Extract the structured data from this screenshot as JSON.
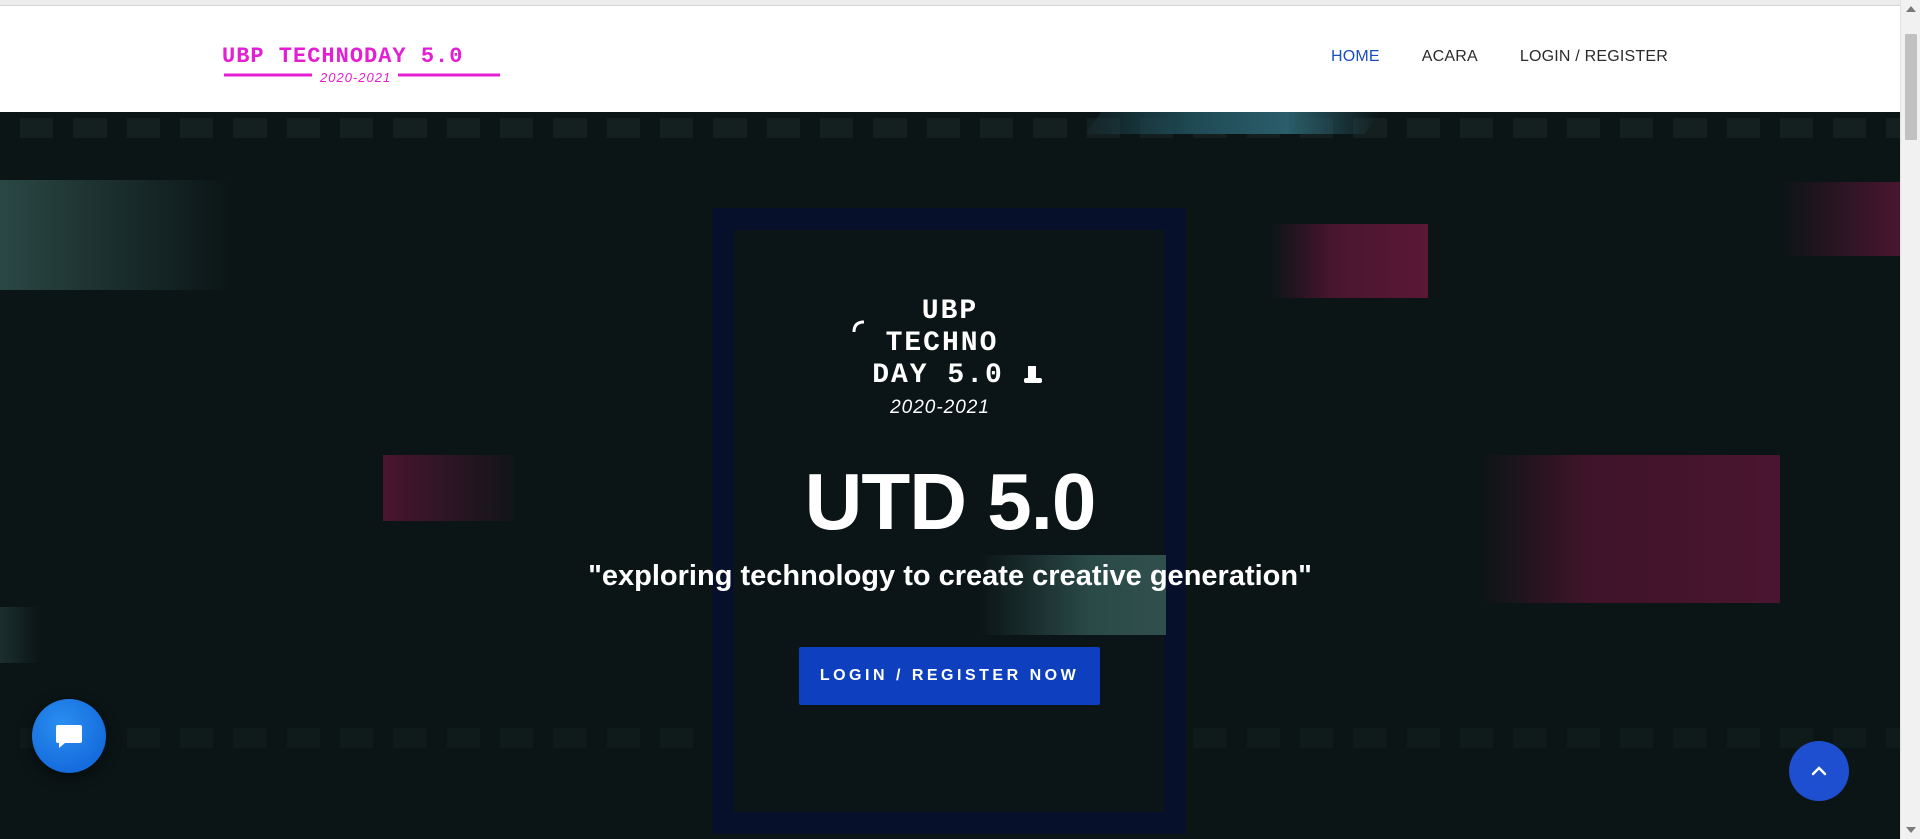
{
  "header": {
    "logo": {
      "main": "UBP TECHNODAY 5.0",
      "sub": "2020-2021"
    },
    "nav": [
      {
        "label": "HOME",
        "active": true
      },
      {
        "label": "ACARA",
        "active": false
      },
      {
        "label": "LOGIN / REGISTER",
        "active": false
      }
    ]
  },
  "hero": {
    "emblem": {
      "line1": "UBP",
      "line2": "TECHNO",
      "line3": "DAY 5.0",
      "years": "2020-2021"
    },
    "title": "UTD 5.0",
    "tagline": "\"exploring technology to create creative generation\"",
    "cta_label": "LOGIN / REGISTER NOW"
  },
  "colors": {
    "logo_magenta": "#e41fd3",
    "nav_active": "#1a4fc4",
    "cta_blue": "#0d3fbf",
    "hero_bg": "#0b1516"
  },
  "icons": {
    "chat": "chat-bubble-icon",
    "scroll_top": "chevron-up-icon"
  }
}
